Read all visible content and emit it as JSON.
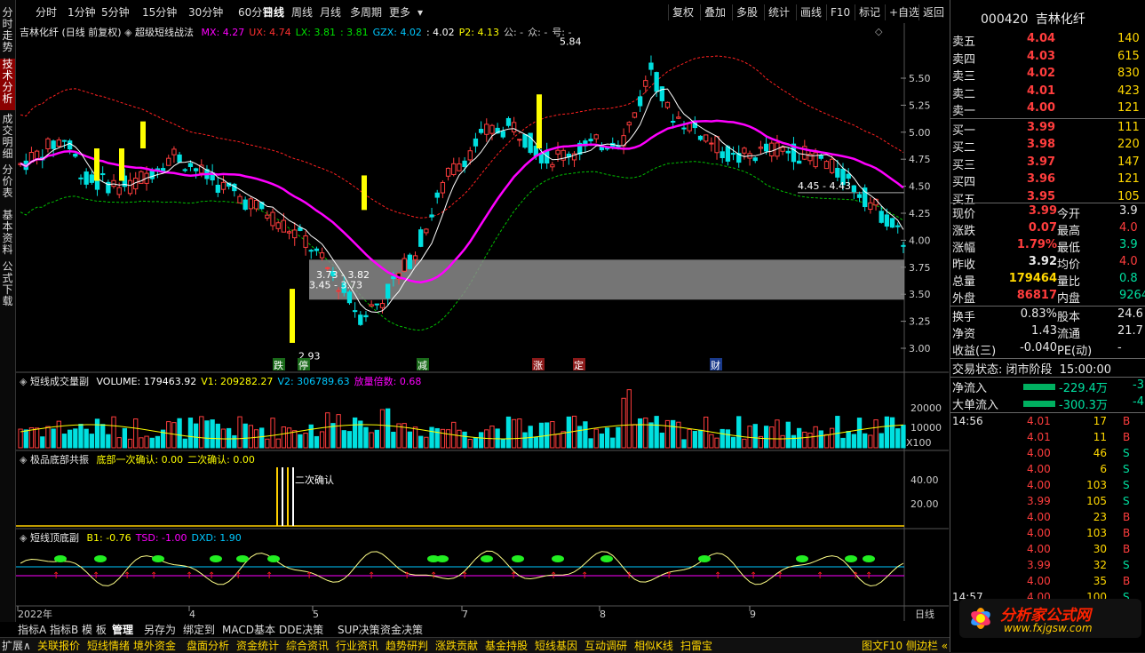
{
  "left_tabs": [
    {
      "label": "分时走势",
      "active": false
    },
    {
      "label": "技术分析",
      "active": true
    },
    {
      "label": "成交明细",
      "active": false
    },
    {
      "label": "分价表",
      "active": false
    },
    {
      "label": "基本资料",
      "active": false
    },
    {
      "label": "公式下载",
      "active": false
    }
  ],
  "toolbar": {
    "periods": [
      "分时",
      "1分钟",
      "5分钟",
      "15分钟",
      "30分钟",
      "60分钟",
      "日线",
      "周线",
      "月线",
      "多周期",
      "更多"
    ],
    "active_period": "日线",
    "more_arrow": "▾",
    "buttons": [
      "复权",
      "叠加",
      "多股",
      "统计",
      "画线",
      "F10",
      "标记",
      "+自选",
      "返回"
    ]
  },
  "main_chart": {
    "title": "吉林化纤 (日线 前复权)",
    "indicator_name": "超级短线战法",
    "indicators": [
      {
        "label": "MX: 4.27",
        "color": "#ff00ff"
      },
      {
        "label": "UX: 4.74",
        "color": "#ff3030"
      },
      {
        "label": "LX: 3.81",
        "color": "#00e000"
      },
      {
        "label": ": 3.81",
        "color": "#00e000"
      },
      {
        "label": "GZX: 4.02",
        "color": "#00c8ff"
      },
      {
        "label": ": 4.02",
        "color": "#ffffff"
      },
      {
        "label": "P2: 4.13",
        "color": "#ffff00"
      },
      {
        "label": "公: -",
        "color": "#cccccc"
      },
      {
        "label": "众: -",
        "color": "#cccccc"
      },
      {
        "label": "号: -",
        "color": "#cccccc"
      }
    ],
    "y_axis": [
      "5.50",
      "5.25",
      "5.00",
      "4.75",
      "4.50",
      "4.25",
      "4.00",
      "3.75",
      "3.50",
      "3.25",
      "3.00"
    ],
    "annotations": [
      {
        "text": "5.84",
        "color": "#ffffff"
      },
      {
        "text": "4.45 - 4.43",
        "color": "#ffffff"
      },
      {
        "text": "3.73 - 3.82",
        "color": "#ffffff"
      },
      {
        "text": "3.45 - 3.73",
        "color": "#ffffff"
      },
      {
        "text": "2.93",
        "color": "#ffffff"
      }
    ],
    "markers": [
      {
        "text": "跌",
        "bg": "#1a6a1a",
        "color": "#ffffff"
      },
      {
        "text": "停",
        "bg": "#1a6a1a",
        "color": "#ffffff"
      },
      {
        "text": "减",
        "bg": "#1a6a1a",
        "color": "#ffffff"
      },
      {
        "text": "涨",
        "bg": "#8b1a1a",
        "color": "#ffffff"
      },
      {
        "text": "定",
        "bg": "#8b1a1a",
        "color": "#ffffff"
      },
      {
        "text": "财",
        "bg": "#1a3a8b",
        "color": "#ffffff"
      }
    ]
  },
  "volume_panel": {
    "title": "短线成交量副",
    "items": [
      {
        "label": "VOLUME: 179463.92",
        "color": "#ffffff"
      },
      {
        "label": "V1: 209282.27",
        "color": "#ffff00"
      },
      {
        "label": "V2: 306789.63",
        "color": "#00c8ff"
      },
      {
        "label": "放量倍数: 0.68",
        "color": "#ff00ff"
      }
    ],
    "y_axis": [
      "20000",
      "10000"
    ],
    "unit": "X100"
  },
  "bottom_panel": {
    "title": "极品底部共振",
    "items": [
      {
        "label": "底部一次确认: 0.00",
        "color": "#ffff00"
      },
      {
        "label": "二次确认: 0.00",
        "color": "#ffff00"
      }
    ],
    "y_axis": [
      "40.00",
      "20.00"
    ],
    "annotation": "二次确认"
  },
  "osc_panel": {
    "title": "短线顶底副",
    "items": [
      {
        "label": "B1: -0.76",
        "color": "#ffff00"
      },
      {
        "label": "TSD: -1.00",
        "color": "#ff00ff"
      },
      {
        "label": "DXD: 1.90",
        "color": "#00c8ff"
      }
    ]
  },
  "x_axis": {
    "labels": [
      "2022年",
      "4",
      "5",
      "7",
      "8",
      "9"
    ],
    "period": "日线"
  },
  "bottom_tabs1": [
    "指标A",
    "指标B",
    "模 板",
    "管理",
    "另存为",
    "绑定到",
    "MACD基本",
    "DDE决策",
    "SUP决策",
    "资金决策"
  ],
  "bottom_tabs1_active": "管理",
  "bottom_tabs2": [
    "扩展∧",
    "关联报价",
    "短线情绪",
    "境外资金",
    "盘面分析",
    "资金统计",
    "综合资讯",
    "行业资讯",
    "趋势研判",
    "涨跌贡献",
    "基金持股",
    "短线基因",
    "互动调研",
    "相似K线",
    "扫雷宝"
  ],
  "bottom_right": "图文F10 侧边栏 «",
  "quote": {
    "code": "000420",
    "name": "吉林化纤",
    "asks": [
      {
        "label": "卖五",
        "price": "4.04",
        "vol": "140"
      },
      {
        "label": "卖四",
        "price": "4.03",
        "vol": "615"
      },
      {
        "label": "卖三",
        "price": "4.02",
        "vol": "830"
      },
      {
        "label": "卖二",
        "price": "4.01",
        "vol": "423"
      },
      {
        "label": "卖一",
        "price": "4.00",
        "vol": "121"
      }
    ],
    "bids": [
      {
        "label": "买一",
        "price": "3.99",
        "vol": "111"
      },
      {
        "label": "买二",
        "price": "3.98",
        "vol": "220"
      },
      {
        "label": "买三",
        "price": "3.97",
        "vol": "147"
      },
      {
        "label": "买四",
        "price": "3.96",
        "vol": "121"
      },
      {
        "label": "买五",
        "price": "3.95",
        "vol": "105"
      }
    ],
    "stats": [
      {
        "l1": "现价",
        "v1": "3.99",
        "c1": "#ff3d3d",
        "l2": "今开",
        "v2": "3.9",
        "c2": "#e8e8e8"
      },
      {
        "l1": "涨跌",
        "v1": "0.07",
        "c1": "#ff3d3d",
        "l2": "最高",
        "v2": "4.0",
        "c2": "#ff3d3d"
      },
      {
        "l1": "涨幅",
        "v1": "1.79%",
        "c1": "#ff3d3d",
        "l2": "最低",
        "v2": "3.9",
        "c2": "#00e0a0"
      },
      {
        "l1": "昨收",
        "v1": "3.92",
        "c1": "#e8e8e8",
        "l2": "均价",
        "v2": "4.0",
        "c2": "#ff3d3d"
      },
      {
        "l1": "总量",
        "v1": "179464",
        "c1": "#ffd700",
        "l2": "量比",
        "v2": "0.8",
        "c2": "#00e0a0"
      },
      {
        "l1": "外盘",
        "v1": "86817",
        "c1": "#ff3d3d",
        "l2": "内盘",
        "v2": "9264",
        "c2": "#00e0a0"
      }
    ],
    "stats2": [
      {
        "l1": "换手",
        "v1": "0.83%",
        "l2": "股本",
        "v2": "24.6"
      },
      {
        "l1": "净资",
        "v1": "1.43",
        "l2": "流通",
        "v2": "21.7"
      },
      {
        "l1": "收益(三)",
        "v1": "-0.040",
        "l2": "PE(动)",
        "v2": "-"
      }
    ],
    "trade_status_label": "交易状态:",
    "trade_status": "闭市阶段",
    "trade_time": "15:00:00",
    "flows": [
      {
        "label": "净流入",
        "value": "-229.4万",
        "extra": "-3"
      },
      {
        "label": "大单流入",
        "value": "-300.3万",
        "extra": "-4"
      }
    ],
    "ticks": [
      {
        "time": "14:56",
        "price": "4.01",
        "vol": "17",
        "side": "B"
      },
      {
        "time": "",
        "price": "4.01",
        "vol": "11",
        "side": "B"
      },
      {
        "time": "",
        "price": "4.00",
        "vol": "46",
        "side": "S"
      },
      {
        "time": "",
        "price": "4.00",
        "vol": "6",
        "side": "S"
      },
      {
        "time": "",
        "price": "4.00",
        "vol": "103",
        "side": "S"
      },
      {
        "time": "",
        "price": "3.99",
        "vol": "105",
        "side": "S"
      },
      {
        "time": "",
        "price": "4.00",
        "vol": "23",
        "side": "B"
      },
      {
        "time": "",
        "price": "4.00",
        "vol": "103",
        "side": "B"
      },
      {
        "time": "",
        "price": "4.00",
        "vol": "30",
        "side": "B"
      },
      {
        "time": "",
        "price": "3.99",
        "vol": "32",
        "side": "S"
      },
      {
        "time": "",
        "price": "4.00",
        "vol": "35",
        "side": "B"
      },
      {
        "time": "14:57",
        "price": "4.00",
        "vol": "100",
        "side": "S"
      }
    ]
  },
  "watermark": {
    "text": "分析家公式网",
    "url": "www.fxjgsw.com"
  },
  "colors": {
    "up": "#ff3d3d",
    "down": "#00e0e0",
    "ma": "#ff00ff",
    "upper": "#ff2020",
    "lower": "#00c000",
    "accent": "#ffff00"
  }
}
